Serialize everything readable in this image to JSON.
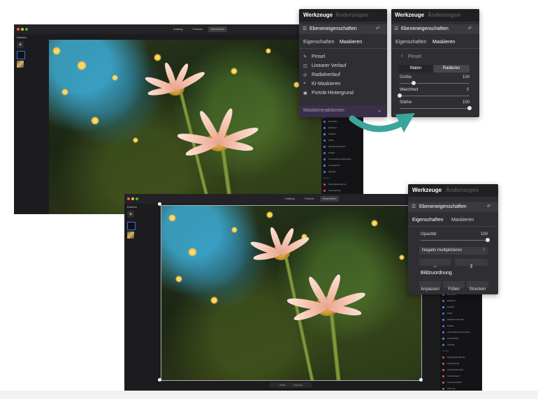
{
  "window1": {
    "toolbar": [
      "Katalog",
      "Presets",
      "Bearbeiten"
    ],
    "layers_title": "Ebenen",
    "sidebar_items": [
      "Einstellen",
      "Radieren",
      "Struktur",
      "Farbe",
      "Schärfe & Rausch.",
      "Details",
      "Chromatische Aberration",
      "Linsenfehler",
      "Vignette"
    ],
    "sidebar_head": "Kreativ",
    "sidebar_items2": [
      "Neigungsänderung",
      "Hintergründe"
    ]
  },
  "window2": {
    "toolbar": [
      "Katalog",
      "Presets",
      "Bearbeiten"
    ],
    "layers_title": "Ebenen",
    "sidebar_items": [
      "Einstellen",
      "Radieren",
      "Struktur",
      "Farbe",
      "Schärfe & Rausch.",
      "Details",
      "Chromatische Aberration",
      "Linsenfehler",
      "Vignette"
    ],
    "sidebar_head": "Kreativ",
    "sidebar_items2": [
      "Neigungsänderung",
      "Hintergründe",
      "Atmosphärenlicht",
      "Schwarzweiß",
      "Sonnenstrahlen",
      "Körnung"
    ],
    "bottom_bar": [
      "Größe",
      "Anpassen"
    ]
  },
  "panel_mask": {
    "tab_tools": "Werkzeuge",
    "tab_changes": "Änderungen",
    "layer_props": "Ebeneneigenschaften",
    "sub_props": "Eigenschaften",
    "sub_mask": "Maskieren",
    "items": [
      "Pinsel",
      "Linearer Verlauf",
      "Radialverlauf",
      "KI-Maskieren",
      "Porträt-Hintergrund"
    ],
    "actions": "Maskierenaktionen"
  },
  "panel_brush": {
    "tab_tools": "Werkzeuge",
    "tab_changes": "Änderungen",
    "layer_props": "Ebeneneigenschaften",
    "sub_props": "Eigenschaften",
    "sub_mask": "Maskieren",
    "back_label": "Pinsel",
    "mode_paint": "Malen",
    "mode_erase": "Radieren",
    "size_label": "Größe",
    "size_value": "100",
    "soft_label": "Weichheit",
    "soft_value": "0",
    "strength_label": "Stärke",
    "strength_value": "100",
    "levels": {
      "size": 0.2,
      "soft": 0.0,
      "strength": 1.0
    }
  },
  "panel_props": {
    "tab_tools": "Werkzeuge",
    "tab_changes": "Änderungen",
    "layer_props": "Ebeneneigenschaften",
    "sub_props": "Eigenschaften",
    "sub_mask": "Maskieren",
    "opacity_label": "Opazität",
    "opacity_value": "100",
    "blend_mode": "Negativ multiplizieren",
    "flip_h": "⇔",
    "flip_v": "⇕",
    "fit_title": "Bildzuordnung",
    "fit_buttons": [
      "Anpassen",
      "Füllen",
      "Strecken"
    ],
    "levels": {
      "opacity": 1.0
    }
  },
  "colors": {
    "accent_arrow": "#3aa59b",
    "panel_bg": "#2f2f33",
    "tab_bar_bg": "#202024"
  },
  "icons": {
    "layers": "layers-icon",
    "undo": "undo-icon",
    "back": "chevron-left-icon",
    "brush": "brush-icon",
    "linear": "linear-gradient-icon",
    "radial": "radial-gradient-icon",
    "ai": "ai-mask-icon",
    "portrait": "portrait-icon",
    "chevron": "chevron-down-icon"
  }
}
